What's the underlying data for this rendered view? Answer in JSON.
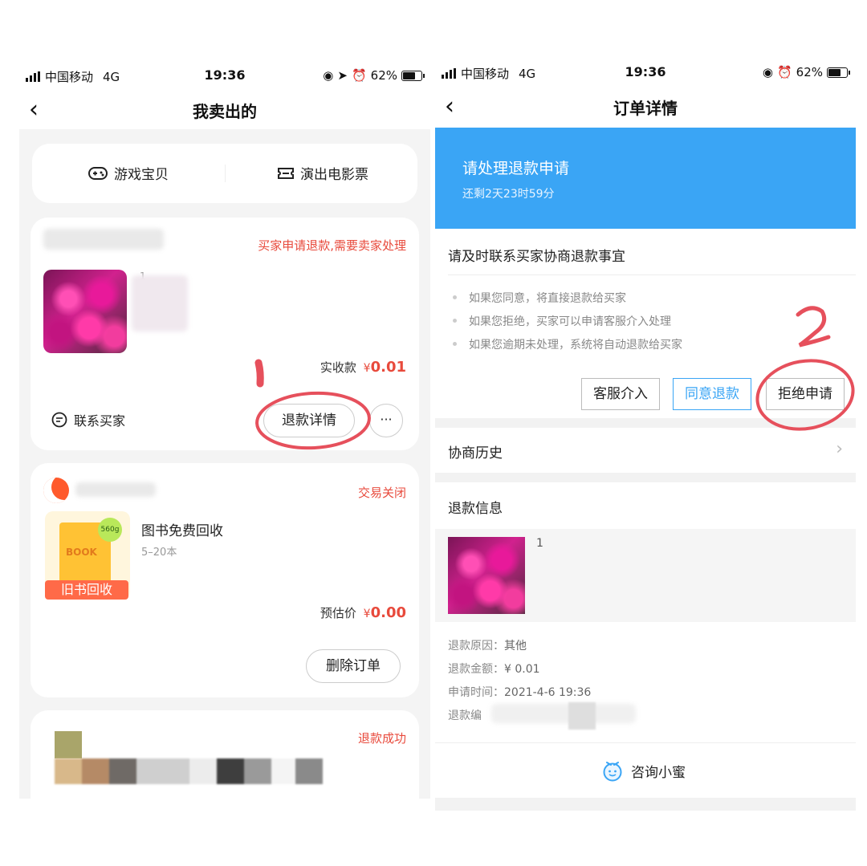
{
  "left": {
    "status": {
      "carrier": "中国移动",
      "network": "4G",
      "time": "19:36",
      "battery": "62%"
    },
    "nav": {
      "back": "‹",
      "title": "我卖出的"
    },
    "categories": [
      {
        "label": "游戏宝贝",
        "icon": "gamepad-icon"
      },
      {
        "label": "演出电影票",
        "icon": "ticket-icon"
      }
    ],
    "order1": {
      "status": "买家申请退款,需要卖家处理",
      "qty": "1",
      "price_label": "实收款",
      "price_symbol": "¥",
      "price": "0.01",
      "contact": "联系买家",
      "refund_btn": "退款详情",
      "more": "···"
    },
    "order2": {
      "status": "交易关闭",
      "title": "图书免费回收",
      "subtitle": "5–20本",
      "banner": "旧书回收",
      "book_text": "BOOK",
      "weight": "560g",
      "price_label": "预估价",
      "price_symbol": "¥",
      "price": "0.00",
      "delete_btn": "删除订单"
    },
    "order3": {
      "status": "退款成功"
    }
  },
  "right": {
    "status": {
      "carrier": "中国移动",
      "network": "4G",
      "time": "19:36",
      "battery": "62%"
    },
    "nav": {
      "back": "‹",
      "title": "订单详情"
    },
    "banner": {
      "title": "请处理退款申请",
      "countdown": "还剩2天23时59分"
    },
    "notice": {
      "heading": "请及时联系买家协商退款事宜",
      "bullets": [
        "如果您同意，将直接退款给买家",
        "如果您拒绝，买家可以申请客服介入处理",
        "如果您逾期未处理，系统将自动退款给买家"
      ],
      "btn_service": "客服介入",
      "btn_agree": "同意退款",
      "btn_reject": "拒绝申请"
    },
    "history": "协商历史",
    "refund_info": {
      "heading": "退款信息",
      "qty": "1",
      "reason_label": "退款原因：",
      "reason": "其他",
      "amount_label": "退款金额：",
      "amount": "¥ 0.01",
      "time_label": "申请时间：",
      "time": "2021-4-6 19:36",
      "number_label": "退款编"
    },
    "consult": "咨询小蜜"
  },
  "annotations": {
    "step1": "1",
    "step2": "2"
  },
  "colors": {
    "accent_red": "#e84a3c",
    "banner_blue": "#3aa5f5",
    "agree_blue": "#3aa5f5",
    "annotation": "#e6505c"
  }
}
